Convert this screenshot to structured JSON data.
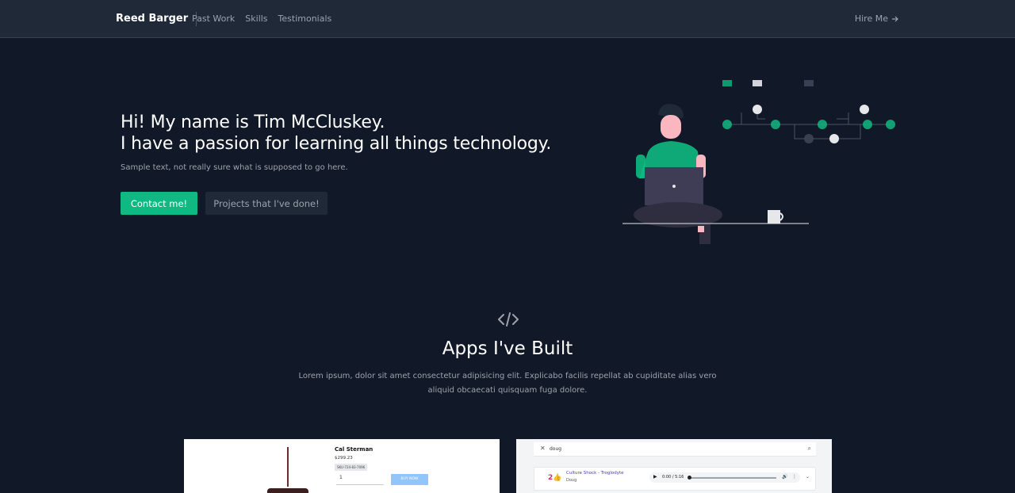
{
  "nav": {
    "brand": "Reed Barger",
    "links": [
      "Past Work",
      "Skills",
      "Testimonials"
    ],
    "cta": "Hire Me",
    "cta_icon": "arrow-right-icon"
  },
  "hero": {
    "line1": "Hi! My name is Tim McCluskey.",
    "line2": "I have a passion for learning all things technology.",
    "subtitle": "Sample text, not really sure what is supposed to go here.",
    "primary_button": "Contact me!",
    "secondary_button": "Projects that I've done!"
  },
  "apps_section": {
    "icon": "code-icon",
    "title": "Apps I've Built",
    "description": "Lorem ipsum, dolor sit amet consectetur adipisicing elit. Explicabo facilis repellat ab cupiditate alias vero aliquid obcaecati quisquam fuga dolore."
  },
  "card1": {
    "product_name": "Cal Sterman",
    "price": "$299.23",
    "chip": "SKU-724-83-7096",
    "quantity": "1",
    "buy_label": "BUY NOW"
  },
  "card2": {
    "search_value": "doug",
    "rank": "2",
    "song_title": "Culture Shock - Troglodyte",
    "artist": "Doug",
    "time": "0:00 / 5:16"
  },
  "colors": {
    "background": "#111827",
    "nav_background": "#1f2937",
    "accent": "#10b981",
    "muted_text": "#9ca3af"
  }
}
